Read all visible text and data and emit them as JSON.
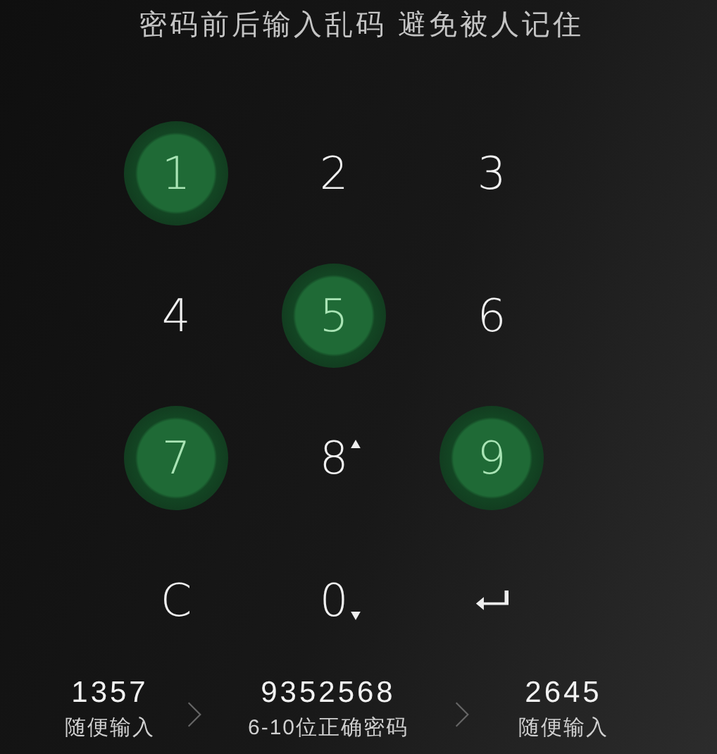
{
  "hint": "密码前后输入乱码 避免被人记住",
  "keys": [
    {
      "kind": "digit",
      "label": "1",
      "selected": true
    },
    {
      "kind": "digit",
      "label": "2",
      "selected": false
    },
    {
      "kind": "digit",
      "label": "3",
      "selected": false
    },
    {
      "kind": "digit",
      "label": "4",
      "selected": false
    },
    {
      "kind": "digit",
      "label": "5",
      "selected": true
    },
    {
      "kind": "digit",
      "label": "6",
      "selected": false
    },
    {
      "kind": "digit",
      "label": "7",
      "selected": true
    },
    {
      "kind": "digit",
      "label": "8",
      "selected": false,
      "arrow_up": true
    },
    {
      "kind": "digit",
      "label": "9",
      "selected": true
    },
    {
      "kind": "clear",
      "label": "C",
      "selected": false
    },
    {
      "kind": "digit",
      "label": "0",
      "selected": false,
      "arrow_down": true
    },
    {
      "kind": "enter",
      "selected": false
    }
  ],
  "steps": [
    {
      "code": "1357",
      "caption": "随便输入"
    },
    {
      "code": "9352568",
      "caption": "6-10位正确密码"
    },
    {
      "code": "2645",
      "caption": "随便输入"
    }
  ]
}
